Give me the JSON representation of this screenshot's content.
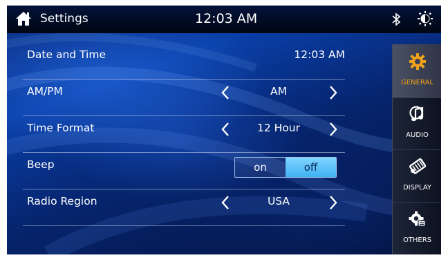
{
  "header": {
    "title": "Settings",
    "clock": "12:03 AM",
    "icons": [
      "home-icon",
      "bluetooth-icon",
      "brightness-icon"
    ]
  },
  "settings": {
    "date_time": {
      "label": "Date and Time",
      "value": "12:03 AM"
    },
    "ampm": {
      "label": "AM/PM",
      "value": "AM"
    },
    "time_format": {
      "label": "Time Format",
      "value": "12 Hour"
    },
    "beep": {
      "label": "Beep",
      "on_label": "on",
      "off_label": "off",
      "selected": "off"
    },
    "radio_region": {
      "label": "Radio Region",
      "value": "USA"
    }
  },
  "sidebar": {
    "active": "GENERAL",
    "tabs": [
      {
        "label": "GENERAL",
        "icon": "gear-icon"
      },
      {
        "label": "AUDIO",
        "icon": "music-note-icon"
      },
      {
        "label": "DISPLAY",
        "icon": "display-icon"
      },
      {
        "label": "OTHERS",
        "icon": "others-icon"
      }
    ]
  },
  "colors": {
    "accent": "#f2a21a",
    "toggle_selected": "#4fbcf5",
    "topbar": "#020a22",
    "background": "#0a3fa8"
  }
}
